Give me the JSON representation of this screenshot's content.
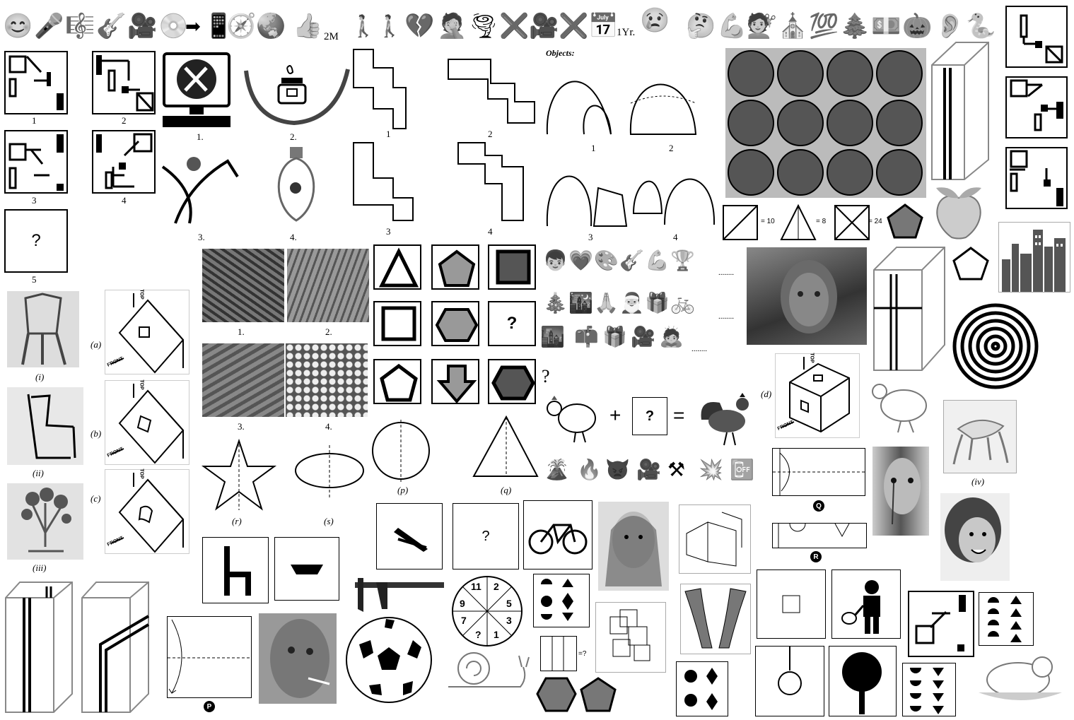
{
  "top_row": {
    "emoji": [
      "😊",
      "🎤",
      "🎼",
      "🎸",
      "🎥",
      "💿",
      "➡",
      "📱",
      "🧭",
      "🌏",
      "👍"
    ],
    "likes_label": "2M",
    "emoji2": [
      "🚶",
      "🚶",
      "💔",
      "🤦",
      "🌪",
      "❌",
      "🎥",
      "❌",
      "📅"
    ],
    "year_label": "1Yr.",
    "emoji3": [
      "😢",
      "🤔",
      "💪",
      "💇",
      "⛪",
      "💯",
      "🌲",
      "💵",
      "🎃",
      "👂",
      "🐍"
    ]
  },
  "matrix_puzzle": {
    "labels": [
      "1",
      "2",
      "3",
      "4",
      "5"
    ],
    "question": "?"
  },
  "logos": {
    "labels": [
      "1.",
      "2.",
      "3.",
      "4."
    ]
  },
  "shapes_puzzle": {
    "labels": [
      "1",
      "2",
      "3",
      "4"
    ]
  },
  "objects": {
    "title": "Objects:",
    "labels": [
      "1",
      "2",
      "3",
      "4"
    ]
  },
  "grid_counts": {
    "eq1": "= 10",
    "eq2": "= 8",
    "eq3": "= 24"
  },
  "chairs": {
    "labels": [
      "(i)",
      "(ii)",
      "(iii)",
      "(iv)"
    ]
  },
  "wedges": {
    "labels": [
      "(a)",
      "(b)",
      "(c)",
      "(d)"
    ],
    "top": "TOP",
    "front": "FRONT"
  },
  "textures": {
    "labels": [
      "1.",
      "2.",
      "3.",
      "4."
    ]
  },
  "symmetry": {
    "labels": [
      "(p)",
      "(q)",
      "(r)",
      "(s)"
    ]
  },
  "shape_matrix": {
    "question": "?"
  },
  "emoji_rows": {
    "row1": [
      "👦",
      "💗",
      "🎨",
      "🎸",
      "💪",
      "🏆"
    ],
    "row2": [
      "🎄",
      "🌃",
      "🙏",
      "🎅",
      "🎁",
      "🚲"
    ],
    "row3": [
      "🌆",
      "📫",
      "🎁",
      "🎥",
      "🙇"
    ],
    "blank": "........",
    "question": "?"
  },
  "equation": {
    "plus": "+",
    "equals": "=",
    "question": "?"
  },
  "emoji_row4": [
    "🌋",
    "🔥",
    "👿",
    "🎥",
    "⚒",
    "💥",
    "📴"
  ],
  "paper_fold": {
    "labels": [
      "Q",
      "R",
      "P"
    ]
  },
  "analogy": {
    "question": "?"
  },
  "wheel": {
    "numbers": [
      "11",
      "2",
      "5",
      "3",
      "1",
      "?",
      "7",
      "9"
    ]
  },
  "pattern": {
    "eq": "=?"
  }
}
